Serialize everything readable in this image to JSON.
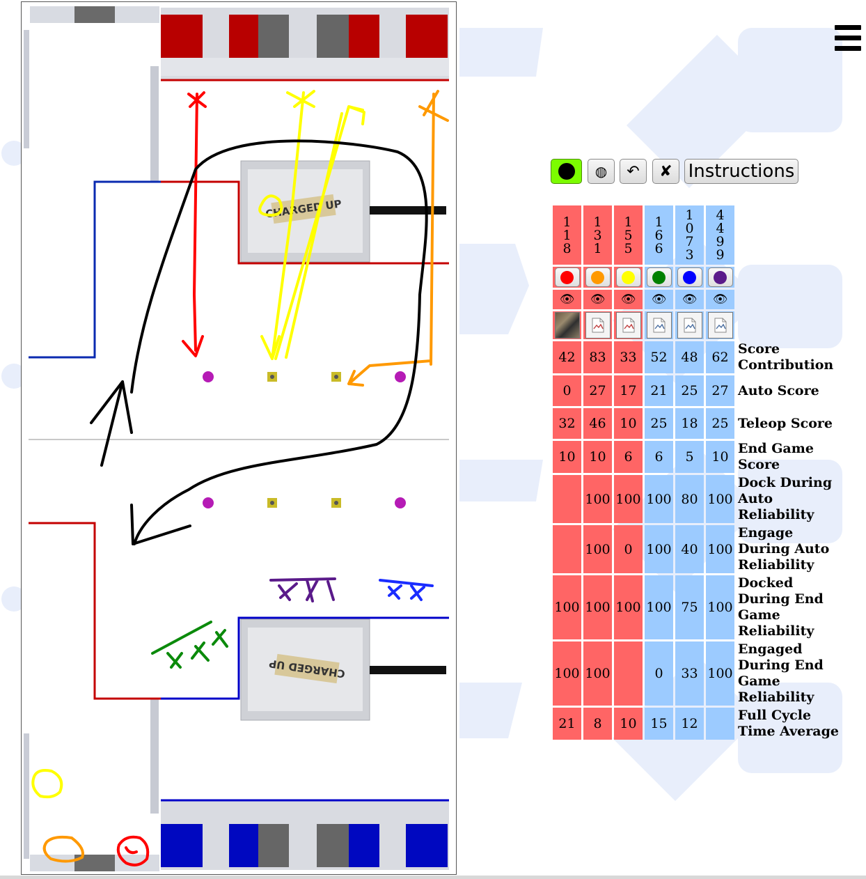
{
  "toolbar": {
    "pen_color_icon": "filled-circle-icon",
    "toggle_label": "◍",
    "undo_label": "↶",
    "clear_label": "✘",
    "instructions_label": "Instructions",
    "pen_color": "#7cfc00"
  },
  "menu": {
    "icon": "hamburger-menu-icon"
  },
  "field": {
    "alliance_colors": {
      "red": "#c40000",
      "blue": "#0000c8"
    },
    "banner_text_top": "CHARGED UP",
    "banner_text_bottom": "CHARGED UP"
  },
  "teams": [
    {
      "number": "118",
      "alliance": "red",
      "marker_color": "#ff0000",
      "thumbnail": "photo"
    },
    {
      "number": "131",
      "alliance": "red",
      "marker_color": "#ff9900",
      "thumbnail": "broken-image-icon"
    },
    {
      "number": "155",
      "alliance": "red",
      "marker_color": "#ffff00",
      "thumbnail": "broken-image-icon"
    },
    {
      "number": "166",
      "alliance": "blue",
      "marker_color": "#008000",
      "thumbnail": "broken-image-icon"
    },
    {
      "number": "1073",
      "alliance": "blue",
      "marker_color": "#0000ff",
      "thumbnail": "broken-image-icon"
    },
    {
      "number": "4499",
      "alliance": "blue",
      "marker_color": "#5a1a8a",
      "thumbnail": "broken-image-icon"
    }
  ],
  "eye_icon": "👁",
  "stats": [
    {
      "label": "Score Contribution",
      "values": [
        "42",
        "83",
        "33",
        "52",
        "48",
        "62"
      ]
    },
    {
      "label": "Auto Score",
      "values": [
        "0",
        "27",
        "17",
        "21",
        "25",
        "27"
      ]
    },
    {
      "label": "Teleop Score",
      "values": [
        "32",
        "46",
        "10",
        "25",
        "18",
        "25"
      ]
    },
    {
      "label": "End Game Score",
      "values": [
        "10",
        "10",
        "6",
        "6",
        "5",
        "10"
      ]
    },
    {
      "label": "Dock During Auto Reliability",
      "values": [
        "",
        "100",
        "100",
        "100",
        "80",
        "100"
      ]
    },
    {
      "label": "Engage During Auto Reliability",
      "values": [
        "",
        "100",
        "0",
        "100",
        "40",
        "100"
      ]
    },
    {
      "label": "Docked During End Game Reliability",
      "values": [
        "100",
        "100",
        "100",
        "100",
        "75",
        "100"
      ]
    },
    {
      "label": "Engaged During End Game Reliability",
      "values": [
        "100",
        "100",
        "",
        "0",
        "33",
        "100"
      ]
    },
    {
      "label": "Full Cycle Time Average",
      "values": [
        "21",
        "8",
        "10",
        "15",
        "12",
        ""
      ]
    }
  ]
}
